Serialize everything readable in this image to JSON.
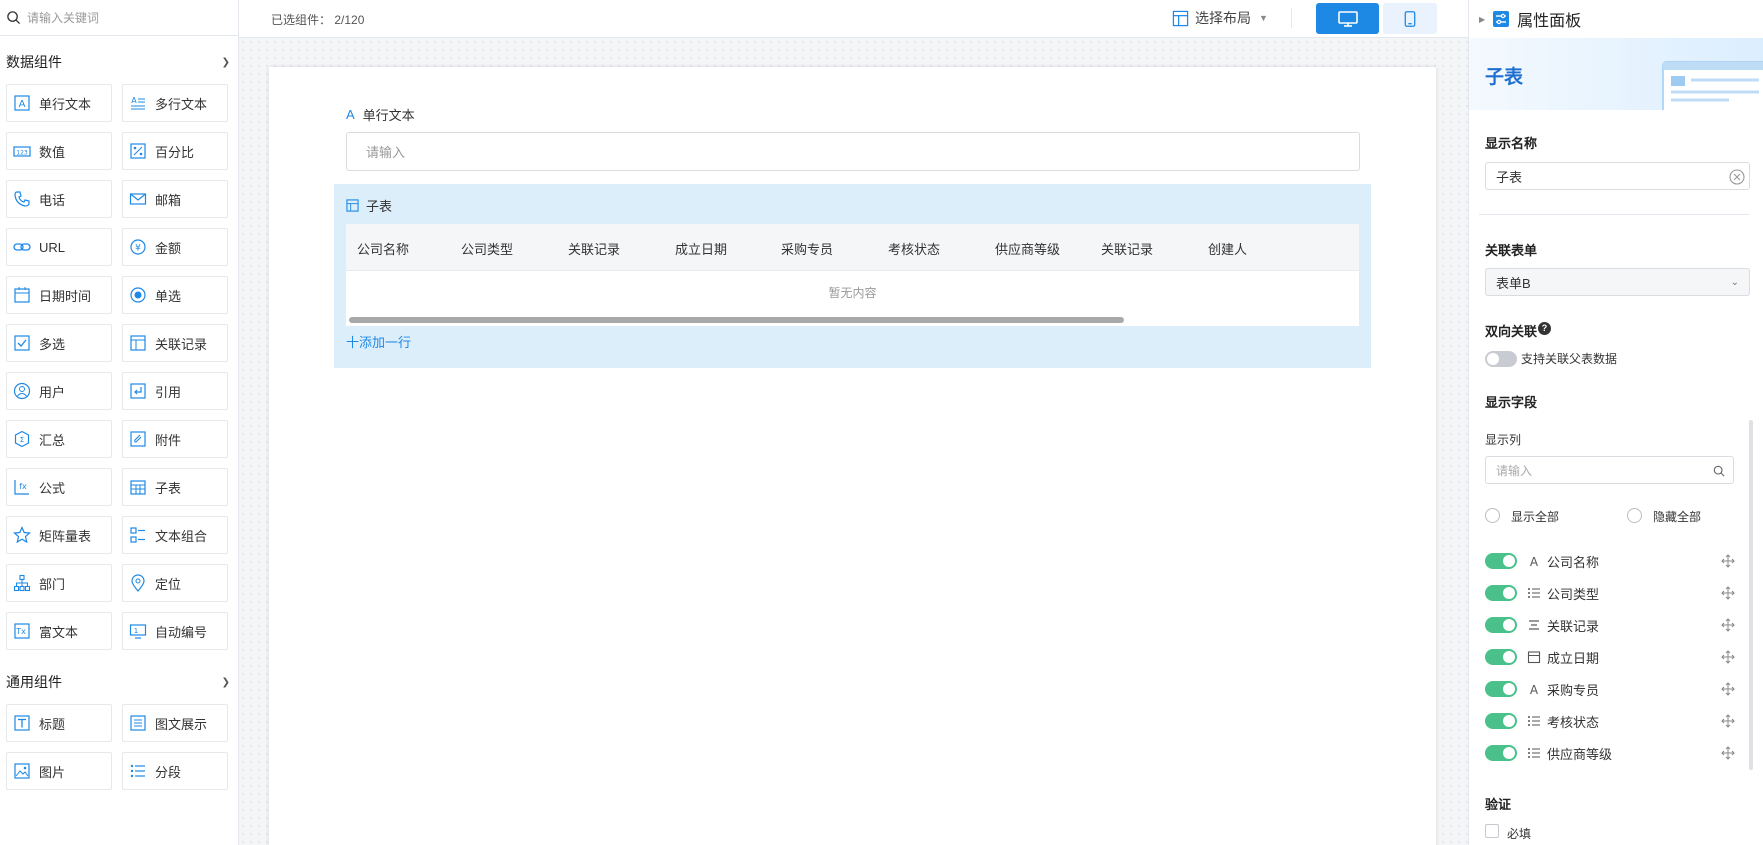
{
  "left": {
    "search_placeholder": "请输入关键词",
    "data_group_title": "数据组件",
    "data_components": [
      {
        "label": "单行文本",
        "icon": "single-line-text-icon"
      },
      {
        "label": "多行文本",
        "icon": "multi-line-text-icon"
      },
      {
        "label": "数值",
        "icon": "number-icon"
      },
      {
        "label": "百分比",
        "icon": "percent-icon"
      },
      {
        "label": "电话",
        "icon": "phone-icon"
      },
      {
        "label": "邮箱",
        "icon": "mail-icon"
      },
      {
        "label": "URL",
        "icon": "link-icon"
      },
      {
        "label": "金额",
        "icon": "currency-icon"
      },
      {
        "label": "日期时间",
        "icon": "calendar-icon"
      },
      {
        "label": "单选",
        "icon": "radio-icon"
      },
      {
        "label": "多选",
        "icon": "checkbox-icon"
      },
      {
        "label": "关联记录",
        "icon": "relation-record-icon"
      },
      {
        "label": "用户",
        "icon": "user-icon"
      },
      {
        "label": "引用",
        "icon": "reference-icon"
      },
      {
        "label": "汇总",
        "icon": "summary-icon"
      },
      {
        "label": "附件",
        "icon": "attachment-icon"
      },
      {
        "label": "公式",
        "icon": "formula-icon"
      },
      {
        "label": "子表",
        "icon": "subtable-icon"
      },
      {
        "label": "矩阵量表",
        "icon": "star-icon"
      },
      {
        "label": "文本组合",
        "icon": "text-combine-icon"
      },
      {
        "label": "部门",
        "icon": "department-icon"
      },
      {
        "label": "定位",
        "icon": "location-pin-icon"
      },
      {
        "label": "富文本",
        "icon": "rich-text-icon"
      },
      {
        "label": "自动编号",
        "icon": "auto-number-icon"
      }
    ],
    "general_group_title": "通用组件",
    "general_components": [
      {
        "label": "标题",
        "icon": "title-icon"
      },
      {
        "label": "图文展示",
        "icon": "image-text-icon"
      },
      {
        "label": "图片",
        "icon": "image-icon"
      },
      {
        "label": "分段",
        "icon": "section-icon"
      }
    ]
  },
  "topbar": {
    "selected_count": "已选组件：  2/120",
    "layout_label": "选择布局"
  },
  "canvas": {
    "field1_label": "单行文本",
    "field1_placeholder": "请输入",
    "subtable": {
      "title": "子表",
      "columns": [
        "公司名称",
        "公司类型",
        "关联记录",
        "成立日期",
        "采购专员",
        "考核状态",
        "供应商等级",
        "关联记录",
        "创建人"
      ],
      "empty_text": "暂无内容",
      "add_row": "十添加一行"
    }
  },
  "right": {
    "title": "属性面板",
    "banner_title": "子表",
    "display_name_label": "显示名称",
    "display_name_value": "子表",
    "related_form_label": "关联表单",
    "related_form_value": "表单B",
    "bidirectional_label": "双向关联",
    "bidirectional_desc": "支持关联父表数据",
    "display_fields_label": "显示字段",
    "display_columns_label": "显示列",
    "column_search_placeholder": "请输入",
    "show_all": "显示全部",
    "hide_all": "隐藏全部",
    "fields": [
      {
        "name": "公司名称",
        "icon": "text-a-icon"
      },
      {
        "name": "公司类型",
        "icon": "list-icon"
      },
      {
        "name": "关联记录",
        "icon": "relation-icon"
      },
      {
        "name": "成立日期",
        "icon": "date-icon"
      },
      {
        "name": "采购专员",
        "icon": "text-a-icon"
      },
      {
        "name": "考核状态",
        "icon": "list-icon"
      },
      {
        "name": "供应商等级",
        "icon": "list-icon"
      }
    ],
    "validation_label": "验证",
    "required_label": "必填"
  }
}
